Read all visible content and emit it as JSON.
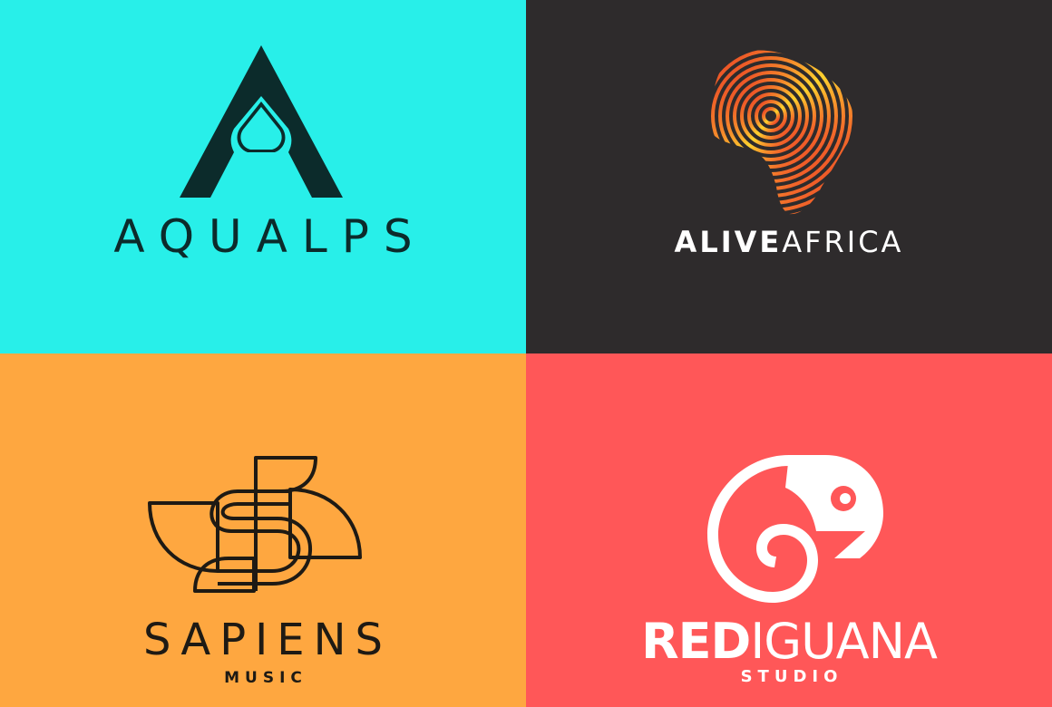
{
  "panels": [
    {
      "id": "aqualps",
      "background": "#28efe9",
      "ink": "#0c2b2b",
      "icon": "water-drop-a-icon",
      "wordmark": "AQUALPS"
    },
    {
      "id": "alive-africa",
      "background": "#2e2b2c",
      "ink": "#ffffff",
      "accent_gradient": [
        "#fdd22e",
        "#f58a2b",
        "#e63424"
      ],
      "icon": "fingerprint-africa-icon",
      "wordmark_bold": "ALIVE",
      "wordmark_light": "AFRICA"
    },
    {
      "id": "sapiens-music",
      "background": "#fea740",
      "ink": "#1e1a14",
      "icon": "line-s-leaf-icon",
      "wordmark": "SAPIENS",
      "subline": "MUSIC"
    },
    {
      "id": "red-iguana",
      "background": "#ff5758",
      "ink": "#ffffff",
      "icon": "chameleon-icon",
      "wordmark_bold": "RED",
      "wordmark_light": "IGUANA",
      "subline": "STUDIO"
    }
  ]
}
